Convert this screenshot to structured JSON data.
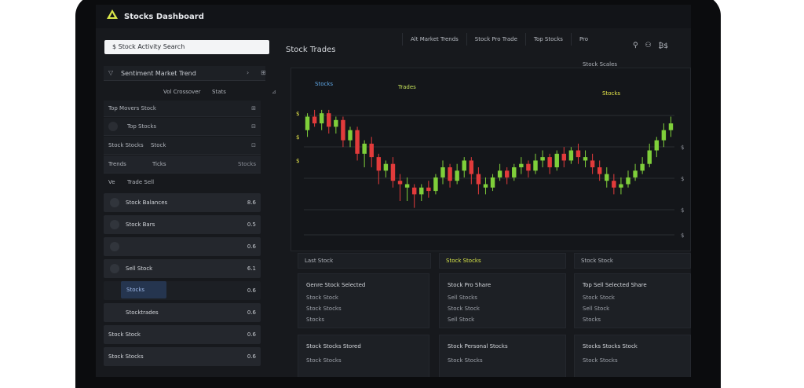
{
  "app": {
    "title": "Stocks Dashboard"
  },
  "top_tabs": [
    "Alt Market Trends",
    "Stock Pro Trade",
    "Top Stocks",
    "Pro"
  ],
  "top_icons": [
    "cart-icon",
    "users-icon",
    "grid-icon"
  ],
  "top_icon_labels": [
    "⚲",
    "⚇",
    "₿$"
  ],
  "search": {
    "value": "$ Stock Activity Search"
  },
  "left": {
    "section": {
      "title": "Sentiment Market Trend",
      "c1": "›",
      "c2": "⊞"
    },
    "subheader": {
      "a": "Vol Crossover",
      "b": "Stats",
      "c": "⊿"
    },
    "rows": [
      {
        "label": "Top Movers Stock",
        "right": "⊞"
      },
      {
        "label": "Top Stocks",
        "right": "⊟"
      },
      {
        "label": "Stock Stocks",
        "mid": "Stock",
        "right": "⊡"
      },
      {
        "label": "Trends",
        "mid": "Ticks",
        "right": "Stocks"
      }
    ],
    "mini_label": "Ve",
    "mini_text": "Trade Sell",
    "items": [
      {
        "text": "Stock Balances",
        "right": "8.6"
      },
      {
        "text": "Stock Bars",
        "right": "0.5"
      },
      {
        "text": "",
        "right": "0.6"
      },
      {
        "text": "Sell Stock",
        "right": "6.1"
      }
    ],
    "blue_button": "Stocks",
    "tail_items": [
      {
        "text": "Stocktrades",
        "right": "0.6"
      },
      {
        "text": "Stock Stock",
        "right": "0.6"
      },
      {
        "text": "Stock Stocks",
        "right": "0.6"
      }
    ]
  },
  "chart": {
    "title": "Stock Trades",
    "subtitle": "Stock Scales",
    "annotations": [
      {
        "text": "Stocks",
        "color": "#5fa8e8"
      },
      {
        "text": "Trades",
        "color": "#c4e05a"
      },
      {
        "text": "Stocks",
        "color": "#e6e64a"
      }
    ],
    "price_ticks": [
      "$",
      "$",
      "$"
    ],
    "right_ticks": [
      "$",
      "$",
      "$",
      "$",
      "$"
    ]
  },
  "chart_data": {
    "type": "candlestick",
    "candles": [
      [
        62,
        70,
        58,
        72,
        "u"
      ],
      [
        70,
        66,
        64,
        74,
        "d"
      ],
      [
        66,
        72,
        62,
        74,
        "u"
      ],
      [
        72,
        64,
        60,
        74,
        "d"
      ],
      [
        64,
        68,
        60,
        70,
        "u"
      ],
      [
        68,
        56,
        52,
        70,
        "d"
      ],
      [
        56,
        62,
        52,
        64,
        "u"
      ],
      [
        62,
        48,
        44,
        64,
        "d"
      ],
      [
        48,
        54,
        40,
        56,
        "u"
      ],
      [
        54,
        46,
        40,
        58,
        "d"
      ],
      [
        46,
        38,
        30,
        48,
        "d"
      ],
      [
        38,
        42,
        34,
        44,
        "u"
      ],
      [
        42,
        32,
        28,
        46,
        "d"
      ],
      [
        32,
        30,
        20,
        36,
        "d"
      ],
      [
        30,
        28,
        20,
        34,
        "u"
      ],
      [
        28,
        24,
        16,
        30,
        "d"
      ],
      [
        24,
        28,
        20,
        30,
        "u"
      ],
      [
        28,
        26,
        22,
        32,
        "d"
      ],
      [
        26,
        34,
        24,
        36,
        "u"
      ],
      [
        34,
        40,
        30,
        44,
        "u"
      ],
      [
        40,
        32,
        28,
        42,
        "d"
      ],
      [
        32,
        38,
        30,
        42,
        "u"
      ],
      [
        38,
        44,
        34,
        46,
        "u"
      ],
      [
        44,
        36,
        30,
        46,
        "d"
      ],
      [
        36,
        30,
        24,
        40,
        "d"
      ],
      [
        30,
        28,
        24,
        34,
        "u"
      ],
      [
        28,
        34,
        26,
        36,
        "u"
      ],
      [
        34,
        38,
        32,
        42,
        "u"
      ],
      [
        38,
        34,
        30,
        40,
        "d"
      ],
      [
        34,
        40,
        32,
        42,
        "u"
      ],
      [
        40,
        42,
        36,
        46,
        "u"
      ],
      [
        42,
        38,
        34,
        44,
        "d"
      ],
      [
        38,
        44,
        36,
        48,
        "u"
      ],
      [
        44,
        46,
        40,
        50,
        "u"
      ],
      [
        46,
        40,
        36,
        48,
        "d"
      ],
      [
        40,
        48,
        38,
        50,
        "u"
      ],
      [
        48,
        44,
        40,
        52,
        "d"
      ],
      [
        44,
        50,
        42,
        52,
        "u"
      ],
      [
        50,
        46,
        42,
        54,
        "d"
      ],
      [
        46,
        44,
        40,
        50,
        "u"
      ],
      [
        44,
        40,
        36,
        48,
        "d"
      ],
      [
        40,
        36,
        32,
        44,
        "d"
      ],
      [
        36,
        32,
        28,
        40,
        "u"
      ],
      [
        32,
        28,
        24,
        36,
        "d"
      ],
      [
        28,
        30,
        24,
        34,
        "u"
      ],
      [
        30,
        34,
        28,
        38,
        "u"
      ],
      [
        34,
        38,
        32,
        42,
        "u"
      ],
      [
        38,
        42,
        36,
        46,
        "u"
      ],
      [
        42,
        50,
        40,
        54,
        "u"
      ],
      [
        50,
        56,
        46,
        58,
        "u"
      ],
      [
        56,
        62,
        52,
        66,
        "u"
      ],
      [
        62,
        66,
        58,
        70,
        "u"
      ]
    ]
  },
  "bottom_tabs": [
    {
      "text": "Last Stock",
      "color": "#b0b4bb"
    },
    {
      "text": "Stock Stocks",
      "color": "#d8e64a"
    },
    {
      "text": "Stock Stock",
      "color": "#b0b4bb"
    }
  ],
  "cards": [
    {
      "title": "Genre Stock Selected",
      "lines": [
        "Stock Stock",
        "Stock Stocks",
        "Stocks"
      ]
    },
    {
      "title": "Stock Pro Share",
      "lines": [
        "Sell Stocks",
        "Stock Stock",
        "Sell Stock"
      ]
    },
    {
      "title": "Top Sell Selected Share",
      "lines": [
        "Stock Stock",
        "Sell Stock",
        "Stocks"
      ]
    },
    {
      "title": "Stock Stocks Stored",
      "lines": [
        "Stock Stocks"
      ]
    },
    {
      "title": "Stock Personal Stocks",
      "lines": [
        "Stock Stocks"
      ]
    },
    {
      "title": "Stocks Stocks Stock",
      "lines": [
        "Stock Stocks"
      ]
    }
  ]
}
